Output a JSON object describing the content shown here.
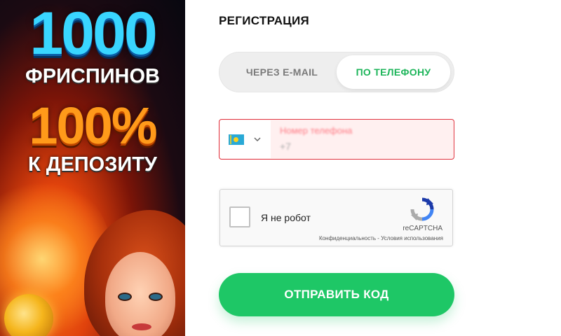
{
  "promo": {
    "line1": "1000",
    "line2": "ФРИСПИНОВ",
    "line3": "100%",
    "line4": "К ДЕПОЗИТУ"
  },
  "form": {
    "title": "РЕГИСТРАЦИЯ",
    "tabs": [
      {
        "label": "ЧЕРЕЗ E-MAIL",
        "active": false
      },
      {
        "label": "ПО ТЕЛЕФОНУ",
        "active": true
      }
    ],
    "phone": {
      "country_icon": "kazakhstan-flag-icon",
      "label": "Номер телефона",
      "value": "+7"
    },
    "captcha": {
      "label": "Я не робот",
      "brand": "reCAPTCHA",
      "links": "Конфиденциальность - Условия использования"
    },
    "submit_label": "ОТПРАВИТЬ КОД"
  },
  "colors": {
    "accent": "#1ec766",
    "active_tab_text": "#1db55a",
    "error_border": "#e0333f"
  }
}
